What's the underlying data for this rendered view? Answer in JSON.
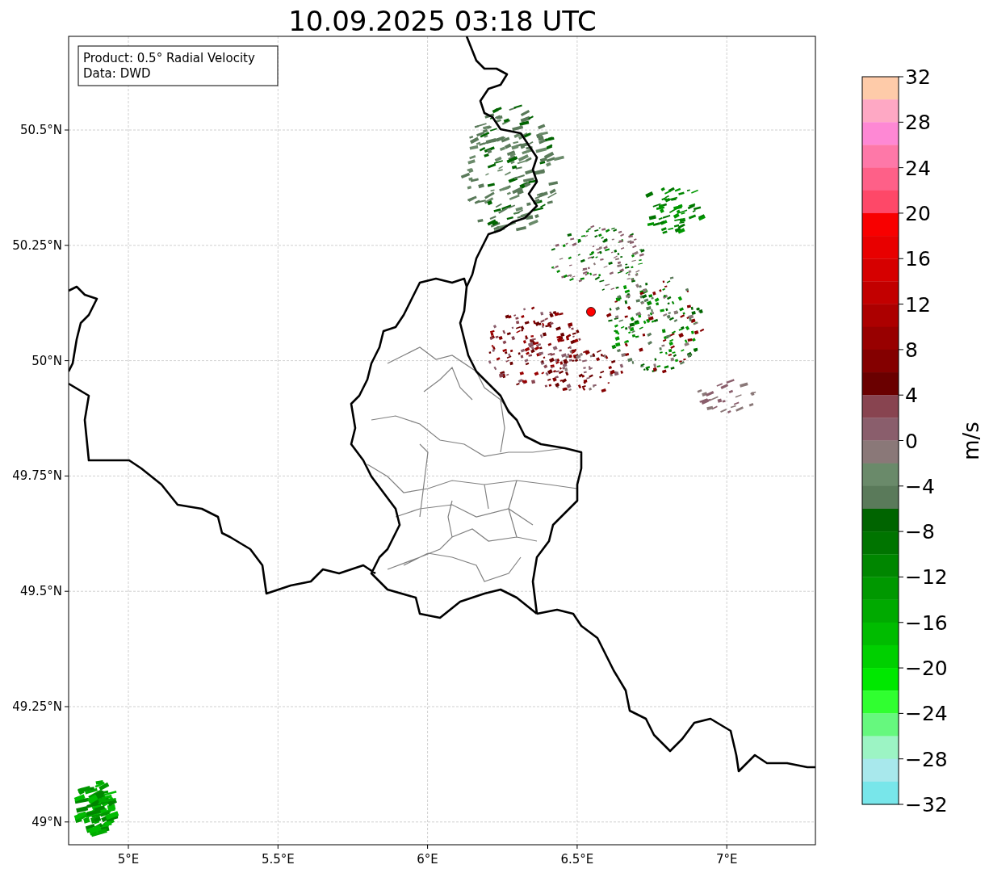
{
  "title": "10.09.2025 03:18 UTC",
  "legend": [
    "Product: 0.5° Radial Velocity",
    "Data: DWD"
  ],
  "map": {
    "lat_ticks": [
      "50.5°N",
      "50.25°N",
      "50°N",
      "49.75°N",
      "49.5°N",
      "49.25°N",
      "49°N"
    ],
    "lon_ticks": [
      "5°E",
      "5.5°E",
      "6°E",
      "6.5°E",
      "7°E"
    ]
  },
  "colorbar": {
    "label": "m/s",
    "ticks": [
      "32",
      "28",
      "24",
      "20",
      "16",
      "12",
      "8",
      "4",
      "0",
      "−4",
      "−8",
      "−12",
      "−16",
      "−20",
      "−24",
      "−28",
      "−32"
    ],
    "bins": [
      {
        "color": "#fecba9"
      },
      {
        "color": "#fea8c4"
      },
      {
        "color": "#fe88d4"
      },
      {
        "color": "#fe78a8"
      },
      {
        "color": "#fe6088"
      },
      {
        "color": "#fe4868"
      },
      {
        "color": "#f80000"
      },
      {
        "color": "#e80000"
      },
      {
        "color": "#d60000"
      },
      {
        "color": "#c20000"
      },
      {
        "color": "#ac0000"
      },
      {
        "color": "#980000"
      },
      {
        "color": "#840000"
      },
      {
        "color": "#6a0000"
      },
      {
        "color": "#884450"
      },
      {
        "color": "#8a5e6c"
      },
      {
        "color": "#8a7878"
      },
      {
        "color": "#6a8a6a"
      },
      {
        "color": "#5a7a5a"
      },
      {
        "color": "#006400"
      },
      {
        "color": "#007400"
      },
      {
        "color": "#008600"
      },
      {
        "color": "#009800"
      },
      {
        "color": "#00aa00"
      },
      {
        "color": "#00bc00"
      },
      {
        "color": "#00d000"
      },
      {
        "color": "#00e800"
      },
      {
        "color": "#30ff30"
      },
      {
        "color": "#66f87e"
      },
      {
        "color": "#9cf4c4"
      },
      {
        "color": "#a8e8ec"
      },
      {
        "color": "#78e6ea"
      }
    ]
  }
}
